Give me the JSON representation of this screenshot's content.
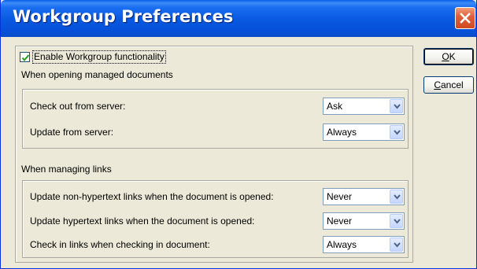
{
  "window": {
    "title": "Workgroup Preferences",
    "close_icon": "close-icon"
  },
  "enable": {
    "checked": true,
    "label": "Enable Workgroup functionality"
  },
  "opening": {
    "heading": "When opening managed documents",
    "rows": [
      {
        "label": "Check out from server:",
        "value": "Ask"
      },
      {
        "label": "Update from server:",
        "value": "Always"
      }
    ]
  },
  "links": {
    "heading": "When managing links",
    "rows": [
      {
        "label": "Update non-hypertext links when the document is opened:",
        "value": "Never"
      },
      {
        "label": "Update hypertext links when the document is opened:",
        "value": "Never"
      },
      {
        "label": "Check in links when checking in document:",
        "value": "Always"
      }
    ]
  },
  "buttons": {
    "ok_mnemonic": "O",
    "ok_rest": "K",
    "cancel_mnemonic": "C",
    "cancel_rest": "ancel"
  }
}
